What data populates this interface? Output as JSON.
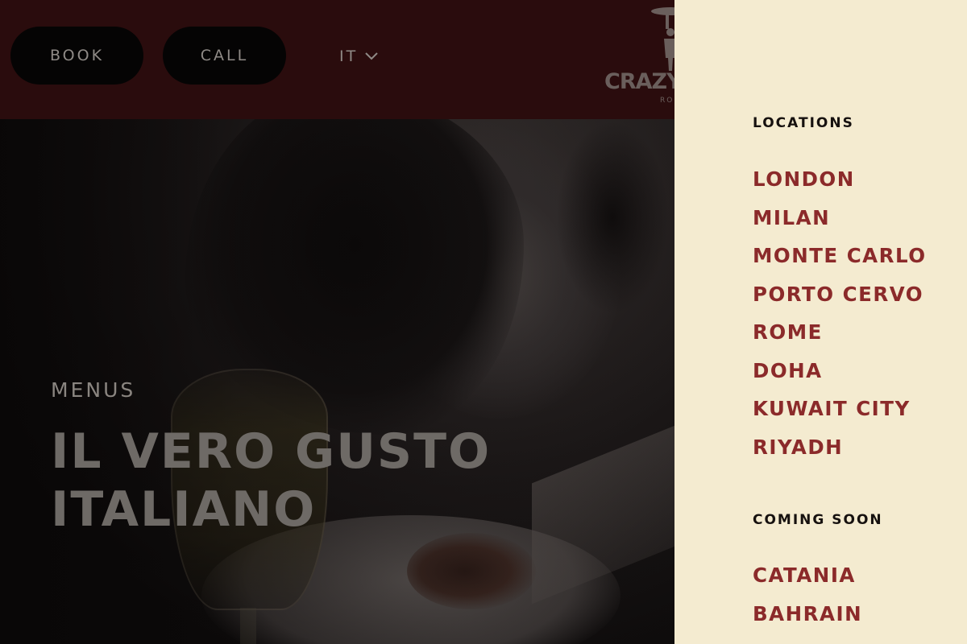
{
  "header": {
    "book_label": "BOOK",
    "call_label": "CALL",
    "language": "IT",
    "logo_text": "CRAZY",
    "logo_subtext": "RO"
  },
  "hero": {
    "eyebrow": "MENUS",
    "title_line1": "IL VERO GUSTO",
    "title_line2": "ITALIANO"
  },
  "panel": {
    "locations_heading": "LOCATIONS",
    "locations": [
      "LONDON",
      "MILAN",
      "MONTE CARLO",
      "PORTO CERVO",
      "ROME",
      "DOHA",
      "KUWAIT CITY",
      "RIYADH"
    ],
    "coming_soon_heading": "COMING SOON",
    "coming_soon": [
      "CATANIA",
      "BAHRAIN"
    ]
  },
  "icons": {
    "language_dropdown": "chevron-down-icon",
    "logo_figure": "waiter-figure-icon"
  },
  "colors": {
    "header_bg": "#2a0c0d",
    "panel_bg": "#f4ebd0",
    "location_text": "#8b2a2a",
    "pill_bg": "#050404"
  }
}
